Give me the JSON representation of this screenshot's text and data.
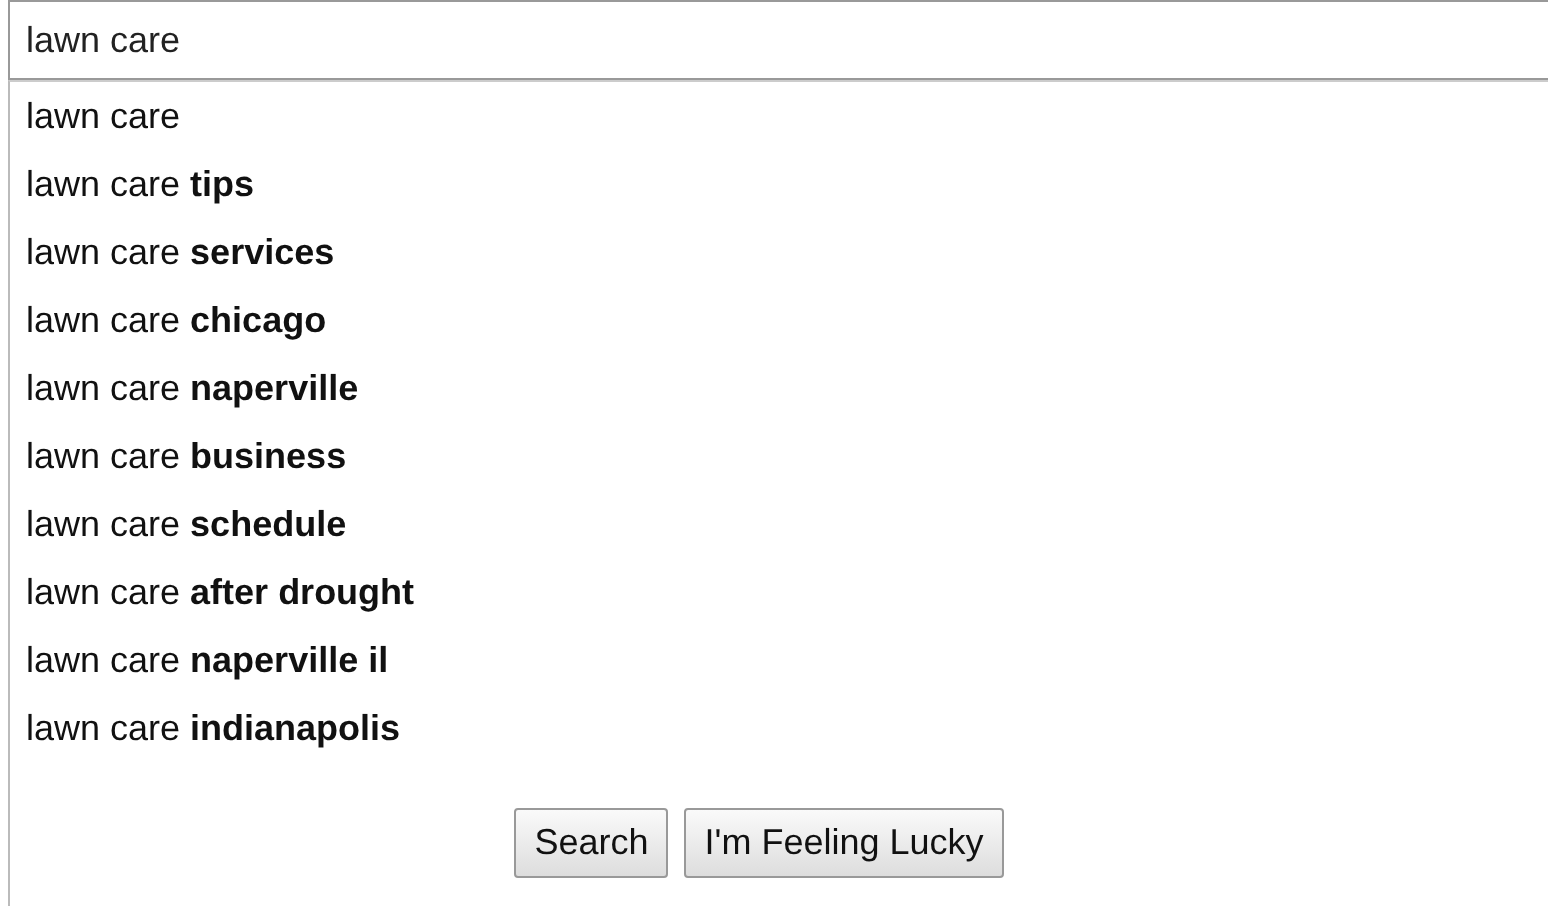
{
  "search": {
    "value": "lawn care"
  },
  "suggestions": [
    {
      "text": "lawn care"
    },
    {
      "text": "lawn care **tips**"
    },
    {
      "text": "lawn care **services**"
    },
    {
      "text": "lawn care **chicago**"
    },
    {
      "text": "lawn care **naperville**"
    },
    {
      "text": "lawn care **business**"
    },
    {
      "text": "lawn care **schedule**"
    },
    {
      "text": "lawn care **after drought**"
    },
    {
      "text": "lawn care **naperville il**"
    },
    {
      "text": "lawn care **indianapolis**"
    }
  ],
  "buttons": [
    "Search",
    "I'm Feeling Lucky"
  ]
}
